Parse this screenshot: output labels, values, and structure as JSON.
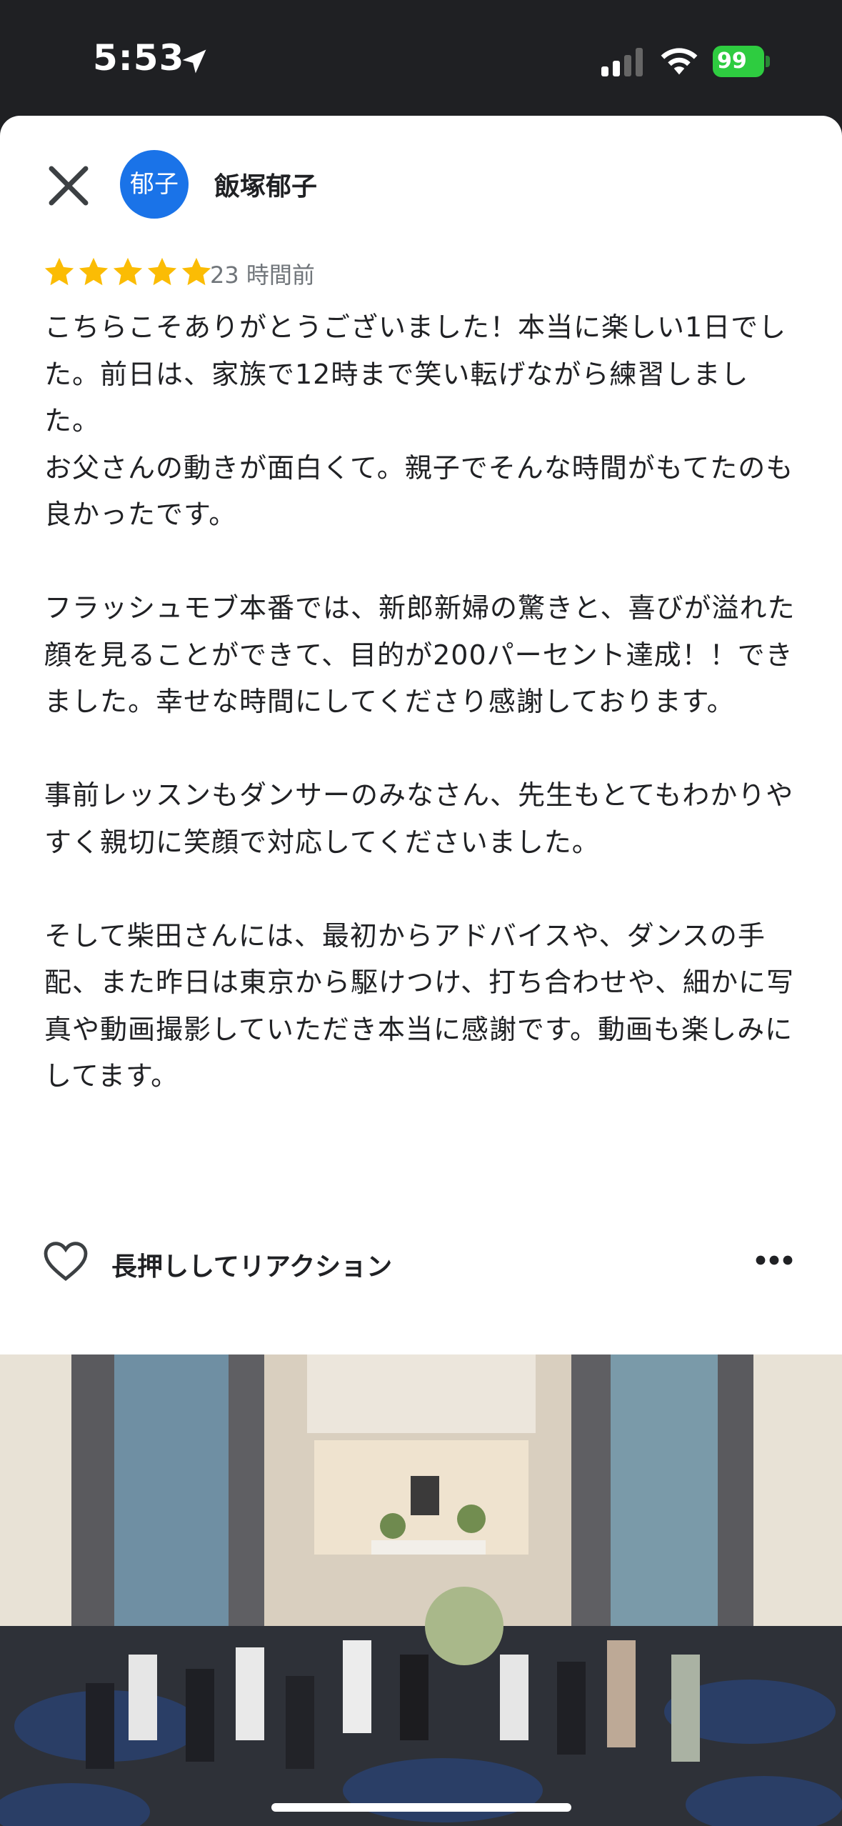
{
  "status": {
    "time": "5:53",
    "battery": "99"
  },
  "reviewer": {
    "avatar_text": "郁子",
    "name": "飯塚郁子"
  },
  "rating": {
    "stars": 5,
    "time_ago": "23 時間前"
  },
  "review": {
    "text": "こちらこそありがとうございました！本当に楽しい1日でした。前日は、家族で12時まで笑い転げながら練習しました。\nお父さんの動きが面白くて。親子でそんな時間がもてたのも良かったです。\n\nフラッシュモブ本番では、新郎新婦の驚きと、喜びが溢れた顔を見ることができて、目的が200パーセント達成！！できました。幸せな時間にしてくださり感謝しております。\n\n事前レッスンもダンサーのみなさん、先生もとてもわかりやすく親切に笑顔で対応してくださいました。\n\nそして柴田さんには、最初からアドバイスや、ダンスの手配、また昨日は東京から駆けつけ、打ち合わせや、細かに写真や動画撮影していただき本当に感謝です。動画も楽しみにしてます。"
  },
  "reaction": {
    "label": "長押ししてリアクション"
  },
  "icons": {
    "location": "location-arrow-icon",
    "signal": "cellular-signal-icon",
    "wifi": "wifi-icon",
    "close": "close-icon",
    "star": "star-icon",
    "heart": "heart-outline-icon",
    "more": "more-horizontal-icon"
  },
  "colors": {
    "avatar": "#1a73e8",
    "star": "#fbbc04",
    "battery": "#2ecc40"
  }
}
